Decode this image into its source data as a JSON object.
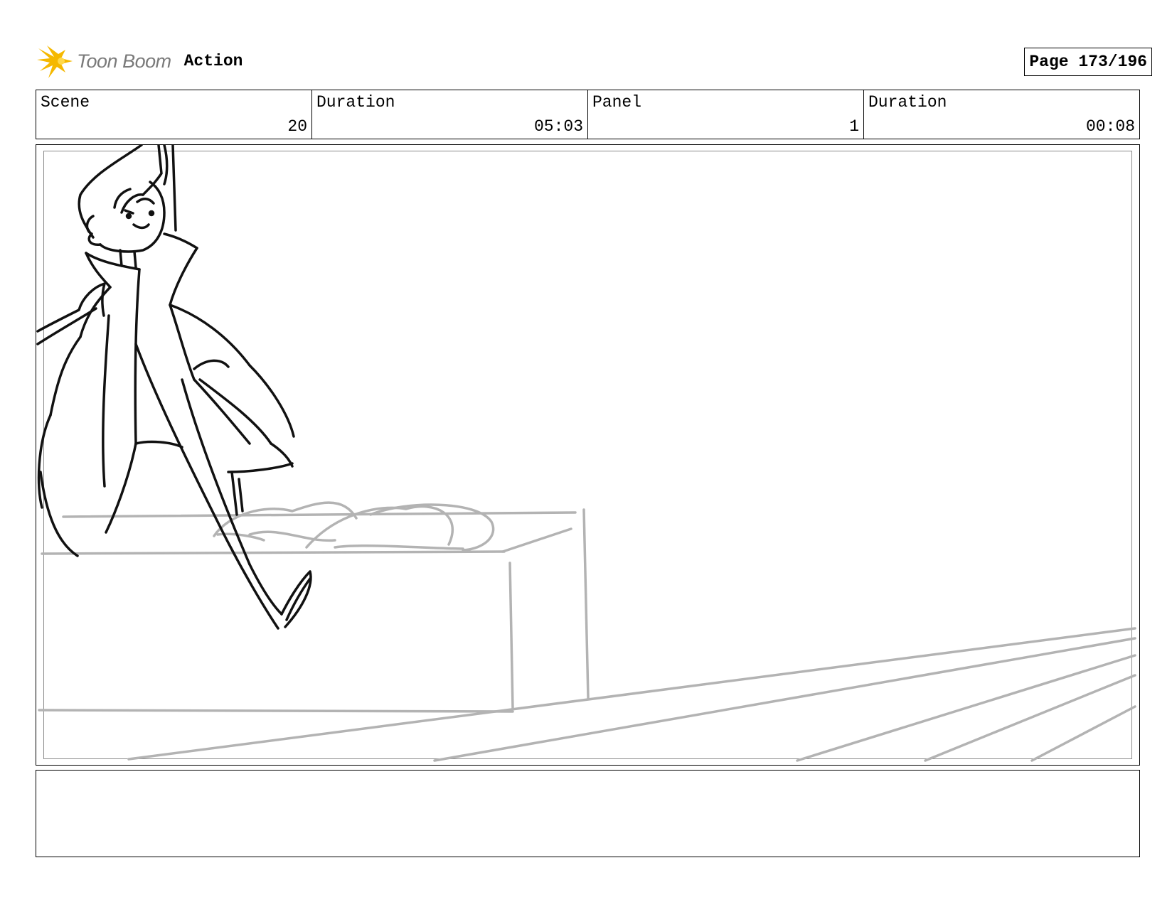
{
  "header": {
    "logo_brand": "Toon Boom",
    "product": "Action",
    "page_label": "Page 173/196"
  },
  "info": {
    "scene_label": "Scene",
    "scene_value": "20",
    "scene_duration_label": "Duration",
    "scene_duration_value": "05:03",
    "panel_label": "Panel",
    "panel_value": "1",
    "panel_duration_label": "Duration",
    "panel_duration_value": "00:08"
  },
  "panel": {
    "image": "storyboard-sketch",
    "notes": ""
  },
  "colors": {
    "sketch_ink": "#111111",
    "sketch_grey": "#b3b3b3",
    "logo_star": "#f5b800"
  }
}
